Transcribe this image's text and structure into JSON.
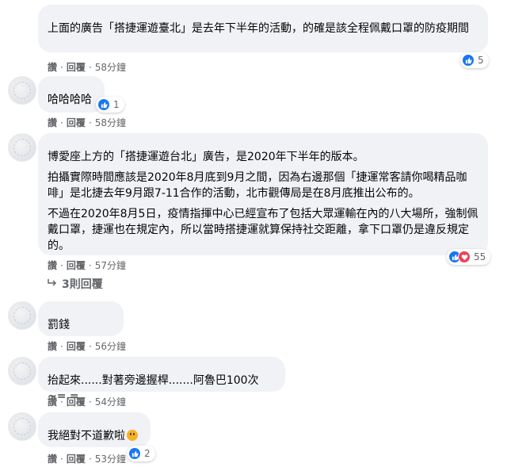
{
  "colors": {
    "like": "#1877f2",
    "love": "#f33e58",
    "bubble": "#f0f2f5",
    "meta": "#65676b"
  },
  "comments": [
    {
      "name": "",
      "paragraphs": [
        "上面的廣告「搭捷運遊臺北」是去年下半年的活動，的確是該全程佩戴口罩的防疫期間"
      ],
      "actions": {
        "read": "讚",
        "reply": "回覆",
        "time": "58分鐘"
      },
      "reactions": {
        "types": [
          "like"
        ],
        "count": "5"
      }
    },
    {
      "name": "",
      "paragraphs": [
        "哈哈哈哈"
      ],
      "actions": {
        "read": "讚",
        "reply": "回覆",
        "time": "58分鐘"
      },
      "reactions": {
        "types": [
          "like"
        ],
        "count": "1"
      }
    },
    {
      "name": "",
      "paragraphs": [
        "博愛座上方的「搭捷運遊台北」廣告，是2020年下半年的版本。",
        "拍攝實際時間應該是2020年8月底到9月之間，因為右邊那個「捷運常客請你喝精品咖啡」是北捷去年9月跟7-11合作的活動，北市觀傳局是在8月底推出公布的。",
        "不過在2020年8月5日，疫情指揮中心已經宣布了包括大眾運輸在內的八大場所，強制佩戴口罩，捷運也在規定內，所以當時搭捷運就算保持社交距離，拿下口罩仍是違反規定的。"
      ],
      "actions": {
        "read": "讚",
        "reply": "回覆",
        "time": "57分鐘"
      },
      "reactions": {
        "types": [
          "like",
          "love"
        ],
        "count": "55"
      },
      "replies_label": "3則回覆"
    },
    {
      "name": "",
      "paragraphs": [
        "罰錢"
      ],
      "actions": {
        "read": "讚",
        "reply": "回覆",
        "time": "56分鐘"
      }
    },
    {
      "name": "",
      "paragraphs": [
        "抬起來......對著旁邊握桿.......阿魯巴100次~=.="
      ],
      "actions": {
        "read": "讚",
        "reply": "回覆",
        "time": "54分鐘"
      }
    },
    {
      "name": "",
      "paragraphs": [
        "我絕對不道歉啦"
      ],
      "actions": {
        "read": "讚",
        "reply": "回覆",
        "time": "53分鐘"
      },
      "reactions": {
        "types": [
          "like"
        ],
        "count": "2"
      }
    }
  ]
}
